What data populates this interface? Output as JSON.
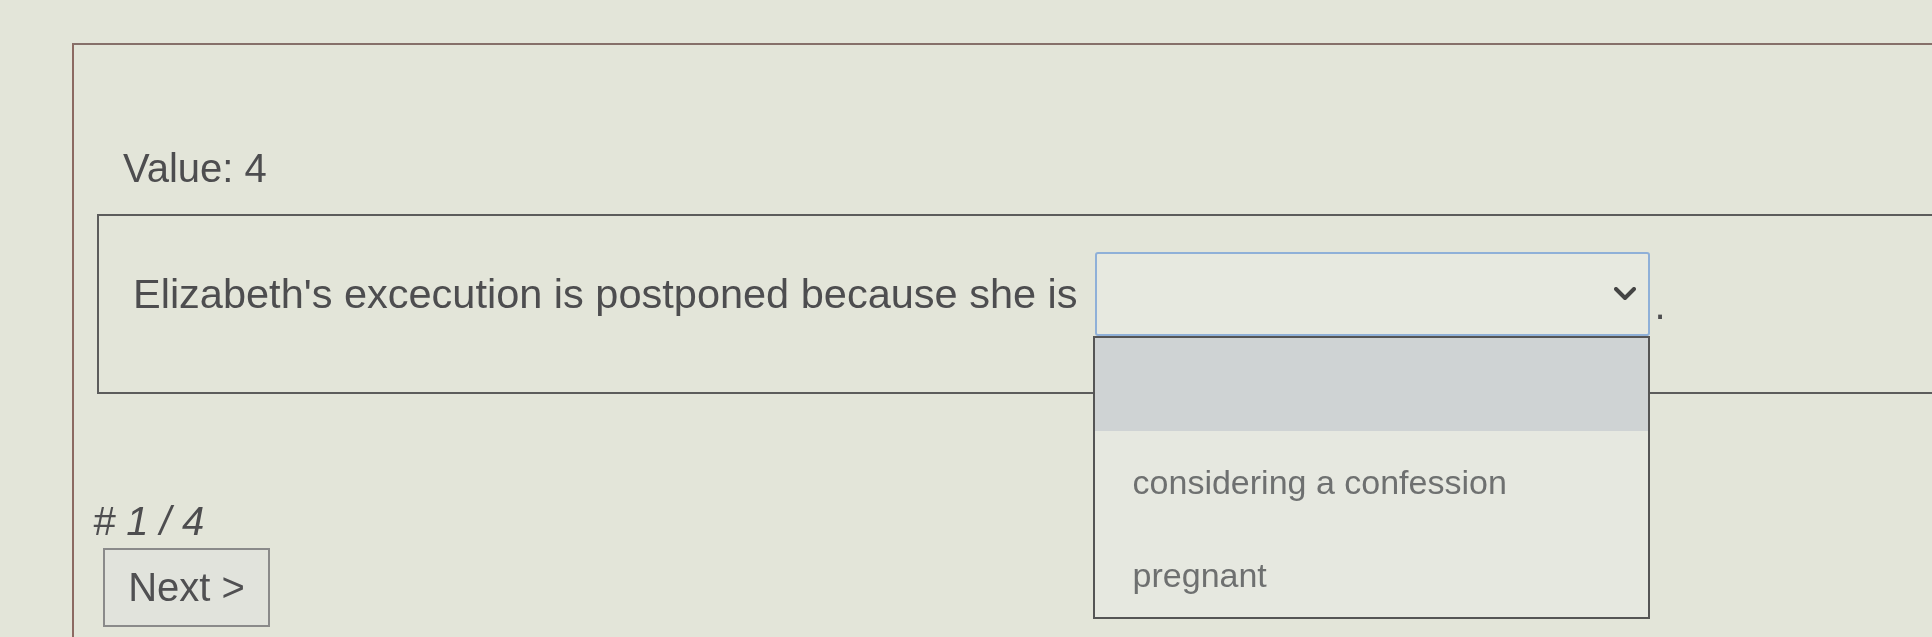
{
  "value_label": "Value: 4",
  "question": {
    "text": "Elizabeth's excecution is postponed because she is",
    "dropdown": {
      "expanded": true,
      "options": [
        {
          "kind": "blank",
          "selected": true
        },
        {
          "kind": "text",
          "label": "considering a confession",
          "selected": false
        },
        {
          "kind": "text",
          "label": "pregnant",
          "selected": false
        }
      ]
    },
    "after": "."
  },
  "pagination": "# 1 / 4",
  "buttons": [
    {
      "label": "Next >"
    }
  ]
}
